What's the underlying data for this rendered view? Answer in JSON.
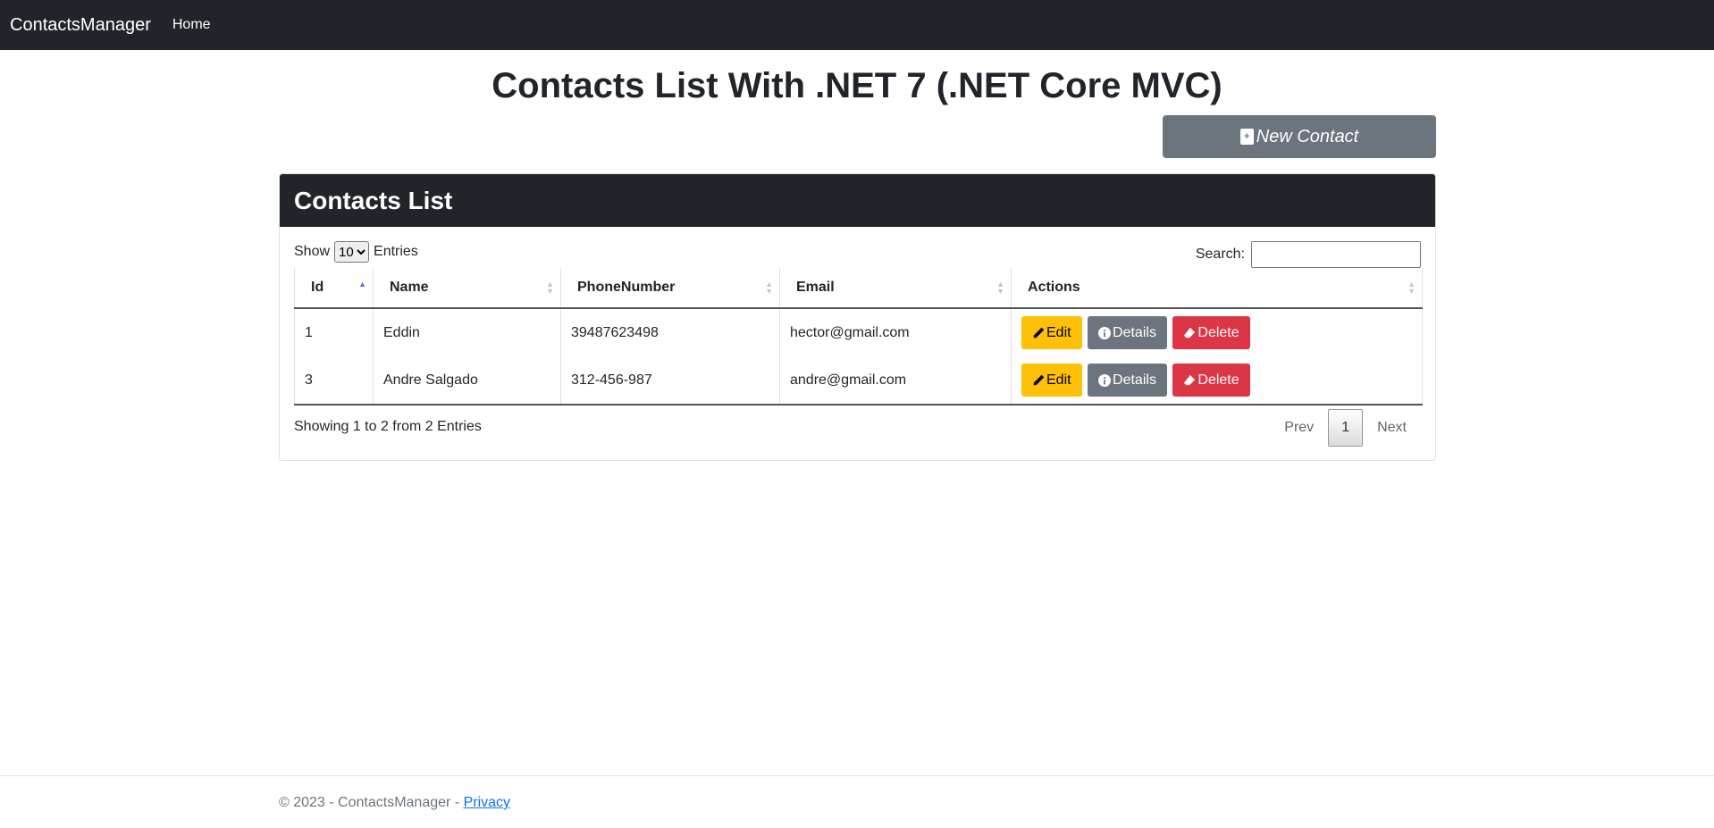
{
  "navbar": {
    "brand": "ContactsManager",
    "home": "Home"
  },
  "page_title": "Contacts List With .NET 7 (.NET Core MVC)",
  "new_contact_label": "New Contact",
  "card": {
    "header": "Contacts List",
    "show_label": "Show",
    "show_value": "10",
    "entries_label": "Entries",
    "search_label": "Search:",
    "search_value": "",
    "columns": [
      "Id",
      "Name",
      "PhoneNumber",
      "Email",
      "Actions"
    ],
    "rows": [
      {
        "id": "1",
        "name": "Eddin",
        "phone": "39487623498",
        "email": "hector@gmail.com"
      },
      {
        "id": "3",
        "name": "Andre Salgado",
        "phone": "312-456-987",
        "email": "andre@gmail.com"
      }
    ],
    "actions": {
      "edit": "Edit",
      "details": "Details",
      "delete": "Delete"
    },
    "showing_text": "Showing 1 to 2 from 2 Entries",
    "pager": {
      "prev": "Prev",
      "current": "1",
      "next": "Next"
    }
  },
  "footer": {
    "text": "© 2023 - ContactsManager - ",
    "privacy": "Privacy"
  },
  "colors": {
    "navbar": "#212529",
    "edit": "#ffc107",
    "details": "#6c757d",
    "delete": "#dc3545",
    "new_contact": "#6c757d"
  }
}
